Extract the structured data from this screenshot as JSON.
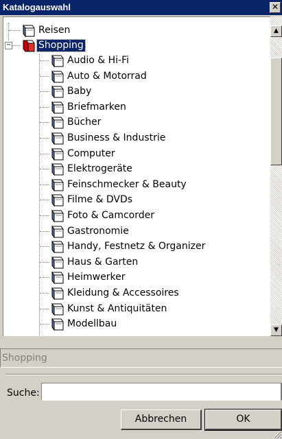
{
  "window": {
    "title": "Katalogauswahl",
    "close_glyph": "✕"
  },
  "tree": {
    "root_items": [
      {
        "label": "Reisen",
        "icon": "book-icon"
      },
      {
        "label": "Shopping",
        "icon": "book-open-red-icon",
        "expanded": true,
        "selected": true,
        "expander": "−"
      }
    ],
    "children": [
      "Audio & Hi-Fi",
      "Auto & Motorrad",
      "Baby",
      "Briefmarken",
      "Bücher",
      "Business & Industrie",
      "Computer",
      "Elektrogeräte",
      "Feinschmecker & Beauty",
      "Filme & DVDs",
      "Foto & Camcorder",
      "Gastronomie",
      "Handy, Festnetz & Organizer",
      "Haus & Garten",
      "Heimwerker",
      "Kleidung & Accessoires",
      "Kunst & Antiquitäten",
      "Modellbau"
    ]
  },
  "scrollbar": {
    "up_glyph": "▲",
    "down_glyph": "▼"
  },
  "selection_field": {
    "value": "Shopping"
  },
  "search": {
    "label": "Suche:",
    "value": ""
  },
  "buttons": {
    "cancel": "Abbrechen",
    "ok": "OK"
  }
}
